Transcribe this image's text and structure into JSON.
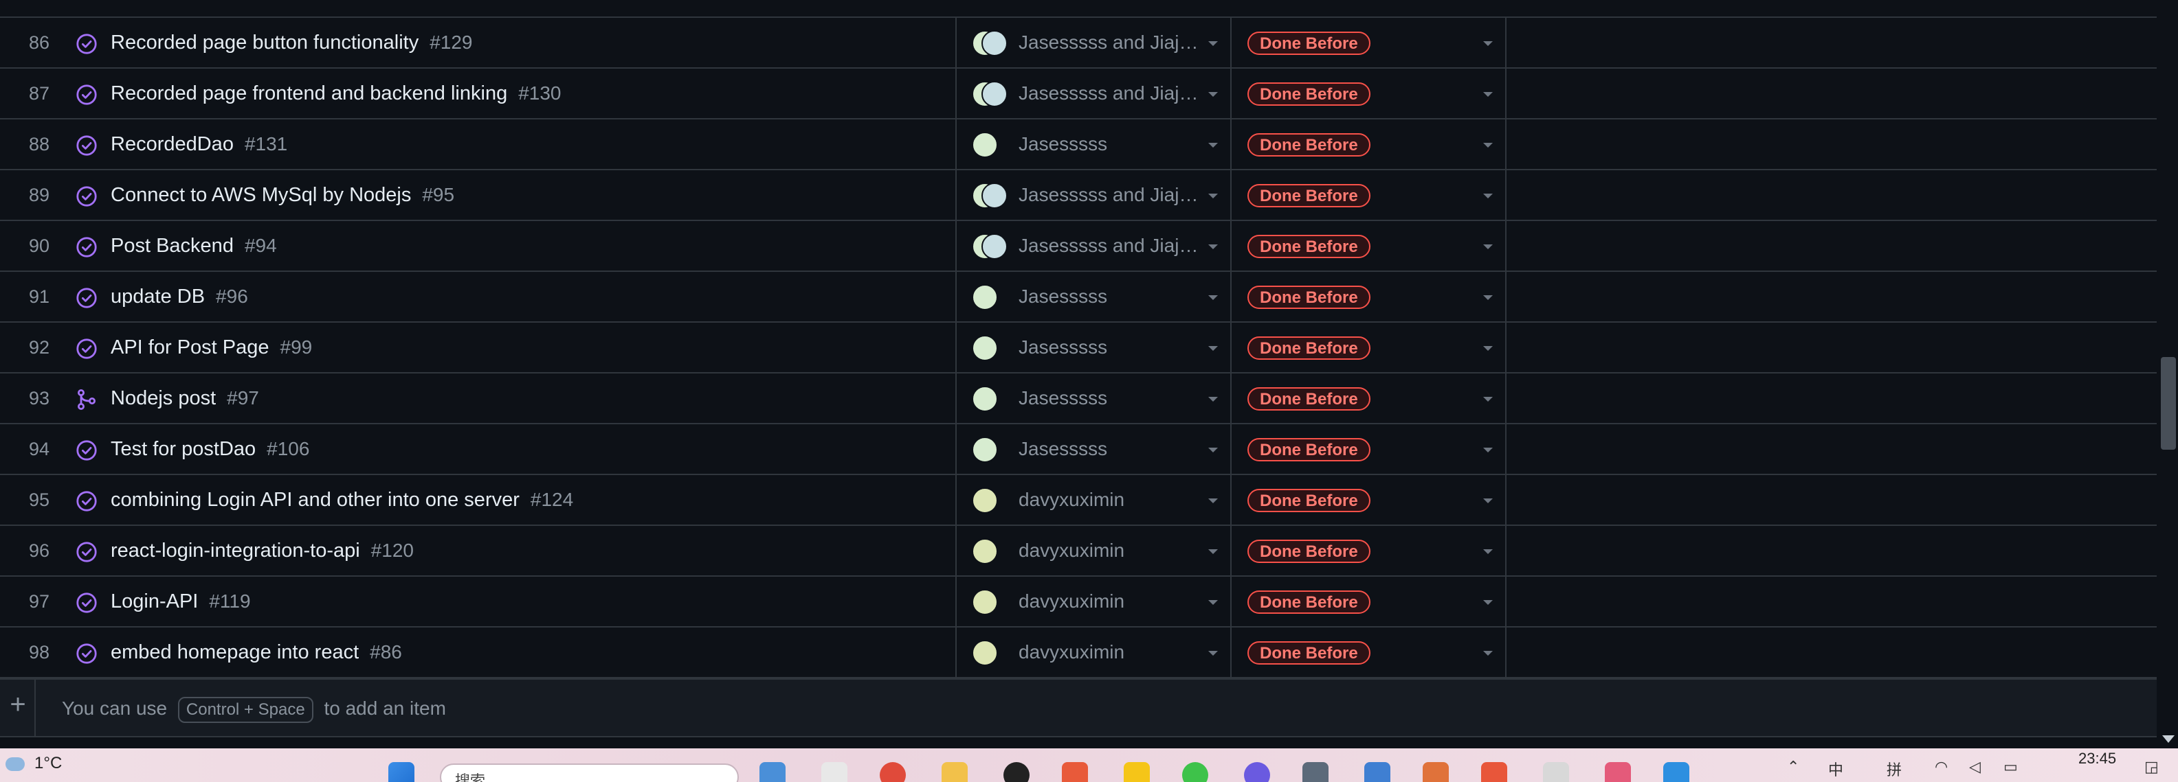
{
  "rows": [
    {
      "num": "86",
      "title": "Recorded page button functionality",
      "issue": "#129",
      "assignee": "Jasesssss and Jiajun…",
      "multi": true,
      "status": "Done Before",
      "icon": "issue-closed-icon"
    },
    {
      "num": "87",
      "title": "Recorded page frontend and backend linking",
      "issue": "#130",
      "assignee": "Jasesssss and Jiajun…",
      "multi": true,
      "status": "Done Before",
      "icon": "issue-closed-icon"
    },
    {
      "num": "88",
      "title": "RecordedDao",
      "issue": "#131",
      "assignee": "Jasesssss",
      "multi": false,
      "status": "Done Before",
      "icon": "issue-closed-icon"
    },
    {
      "num": "89",
      "title": "Connect to AWS MySql by Nodejs",
      "issue": "#95",
      "assignee": "Jasesssss and Jiajun…",
      "multi": true,
      "status": "Done Before",
      "icon": "issue-closed-icon"
    },
    {
      "num": "90",
      "title": "Post Backend",
      "issue": "#94",
      "assignee": "Jasesssss and Jiajun…",
      "multi": true,
      "status": "Done Before",
      "icon": "issue-closed-icon"
    },
    {
      "num": "91",
      "title": "update DB",
      "issue": "#96",
      "assignee": "Jasesssss",
      "multi": false,
      "status": "Done Before",
      "icon": "issue-closed-icon"
    },
    {
      "num": "92",
      "title": "API for Post Page",
      "issue": "#99",
      "assignee": "Jasesssss",
      "multi": false,
      "status": "Done Before",
      "icon": "issue-closed-icon"
    },
    {
      "num": "93",
      "title": "Nodejs post",
      "issue": "#97",
      "assignee": "Jasesssss",
      "multi": false,
      "status": "Done Before",
      "icon": "pull-request-merged-icon"
    },
    {
      "num": "94",
      "title": "Test for postDao",
      "issue": "#106",
      "assignee": "Jasesssss",
      "multi": false,
      "status": "Done Before",
      "icon": "issue-closed-icon"
    },
    {
      "num": "95",
      "title": "combining Login API and other into one server",
      "issue": "#124",
      "assignee": "davyxuximin",
      "multi": false,
      "status": "Done Before",
      "icon": "issue-closed-icon"
    },
    {
      "num": "96",
      "title": "react-login-integration-to-api",
      "issue": "#120",
      "assignee": "davyxuximin",
      "multi": false,
      "status": "Done Before",
      "icon": "issue-closed-icon"
    },
    {
      "num": "97",
      "title": "Login-API",
      "issue": "#119",
      "assignee": "davyxuximin",
      "multi": false,
      "status": "Done Before",
      "icon": "issue-closed-icon"
    },
    {
      "num": "98",
      "title": "embed homepage into react",
      "issue": "#86",
      "assignee": "davyxuximin",
      "multi": false,
      "status": "Done Before",
      "icon": "issue-closed-icon"
    }
  ],
  "add_item": {
    "prefix": "You can use",
    "shortcut": "Control + Space",
    "suffix": "to add an item"
  },
  "taskbar": {
    "temperature": "1°C",
    "search_placeholder": "搜索",
    "time": "23:45"
  },
  "colors": {
    "background": "#0d1117",
    "accent_purple": "#a371f7",
    "done_badge": "#f85149"
  }
}
